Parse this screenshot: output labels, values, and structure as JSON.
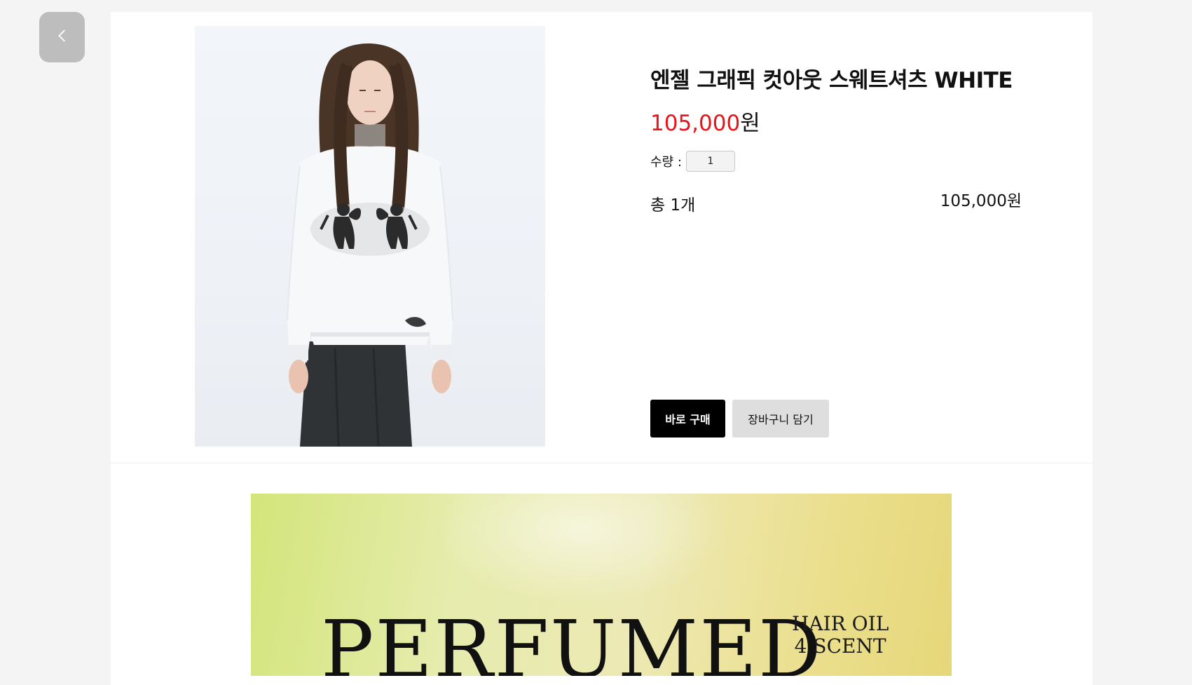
{
  "back_button": {
    "icon": "chevron-left-icon"
  },
  "product": {
    "title": "엔젤 그래픽 컷아웃 스웨트셔츠 WHITE",
    "image": {
      "icon": "product-photo"
    },
    "price": {
      "amount": "105,000",
      "unit": "원"
    },
    "quantity": {
      "label": "수량 :",
      "value": "1"
    },
    "total": {
      "count_label": "총 1개",
      "price": "105,000원"
    }
  },
  "actions": {
    "buy_now": "바로 구매",
    "add_to_cart": "장바구니 담기"
  },
  "banner": {
    "headline": "PERFUMED",
    "side_line_1": "HAIR OIL",
    "side_line_2": "4 SCENT"
  },
  "colors": {
    "price_accent": "#e8141c",
    "primary_button": "#000000",
    "secondary_button": "#dedede",
    "page_background": "#f4f4f4"
  }
}
